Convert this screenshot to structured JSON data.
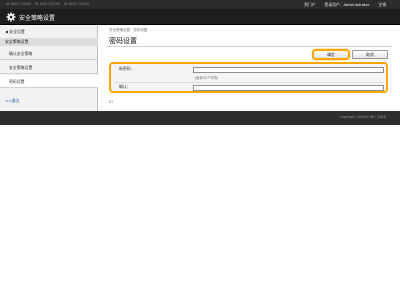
{
  "topbar": {
    "crumbs": [
      "iR-ADV C5560",
      "iR-ADV C5550",
      "iR-ADV C5560"
    ],
    "portal_link": "到门户",
    "login_label": "登录用户：",
    "user_name": "Administrator",
    "logout_link": "注销"
  },
  "header": {
    "title": "安全策略设置"
  },
  "sidebar": {
    "back_link": "◀ 安全设置",
    "section_title": "安全策略设置",
    "items": [
      {
        "label": "确认安全策略"
      },
      {
        "label": "安全策略设置"
      },
      {
        "label": "密码设置"
      }
    ],
    "logout_link": "<<退出"
  },
  "main": {
    "breadcrumb": "安全策略设置 : 密码设置",
    "page_title": "密码设置",
    "ok_button": "确定",
    "cancel_button": "取消",
    "form": {
      "new_password_label": "新密码：",
      "hint": "(最多32个字符)",
      "confirm_label": "确认："
    },
    "footnote_mark": "☐"
  },
  "footer": {
    "copyright": "Copyright CANON INC. 2016"
  },
  "colors": {
    "highlight": "#ffa500",
    "topbar": "#2b2b2b",
    "titlebar": "#1e1e1e"
  }
}
